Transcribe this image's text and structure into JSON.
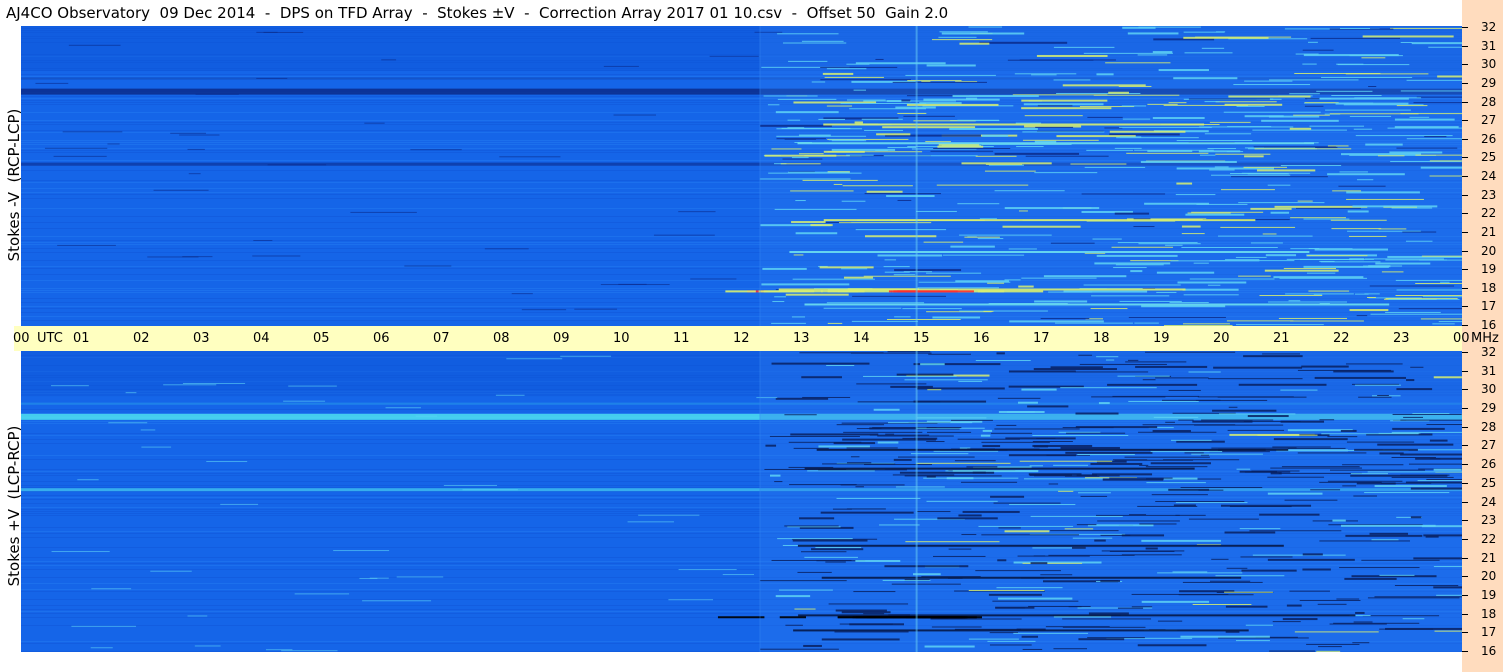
{
  "title": "AJ4CO Observatory  09 Dec 2014  -  DPS on TFD Array  -  Stokes ±V  -  Correction Array 2017 01 10.csv  -  Offset 50  Gain 2.0",
  "chart_data": [
    {
      "type": "heatmap",
      "panel": "top",
      "ylabel": "Stokes -V  (RCP-LCP)",
      "x_axis": {
        "unit_label": "UTC",
        "ticks": [
          "00",
          "01",
          "02",
          "03",
          "04",
          "05",
          "06",
          "07",
          "08",
          "09",
          "10",
          "11",
          "12",
          "13",
          "14",
          "15",
          "16",
          "17",
          "18",
          "19",
          "20",
          "21",
          "22",
          "23",
          "00"
        ],
        "range_hours": [
          0,
          24
        ]
      },
      "y_axis": {
        "unit_label": "MHz",
        "ticks": [
          32,
          31,
          30,
          29,
          28,
          27,
          26,
          25,
          24,
          23,
          22,
          21,
          20,
          19,
          18,
          17,
          16
        ],
        "range": [
          16,
          32
        ]
      },
      "activity_onset_utc": 12.3
    },
    {
      "type": "heatmap",
      "panel": "bottom",
      "ylabel": "Stokes +V  (LCP-RCP)",
      "x_axis": {
        "unit_label": "UTC",
        "ticks": [
          "00",
          "01",
          "02",
          "03",
          "04",
          "05",
          "06",
          "07",
          "08",
          "09",
          "10",
          "11",
          "12",
          "13",
          "14",
          "15",
          "16",
          "17",
          "18",
          "19",
          "20",
          "21",
          "22",
          "23",
          "00"
        ],
        "range_hours": [
          0,
          24
        ]
      },
      "y_axis": {
        "unit_label": "MHz",
        "ticks": [
          32,
          31,
          30,
          29,
          28,
          27,
          26,
          25,
          24,
          23,
          22,
          21,
          20,
          19,
          18,
          17,
          16
        ],
        "range": [
          16,
          32
        ]
      },
      "activity_onset_utc": 12.3
    }
  ],
  "time_axis": {
    "unit_utc": "UTC",
    "unit_mhz": "MHz"
  },
  "colors": {
    "background_blue": "#1565e8",
    "dark_band": "#0a2a8a",
    "bright_band": "#4de0f0",
    "highlight": "#d8f070",
    "hot": "#ff3030",
    "axis_bg": "#ffffc0",
    "freq_strip": "#ffdcbe"
  }
}
